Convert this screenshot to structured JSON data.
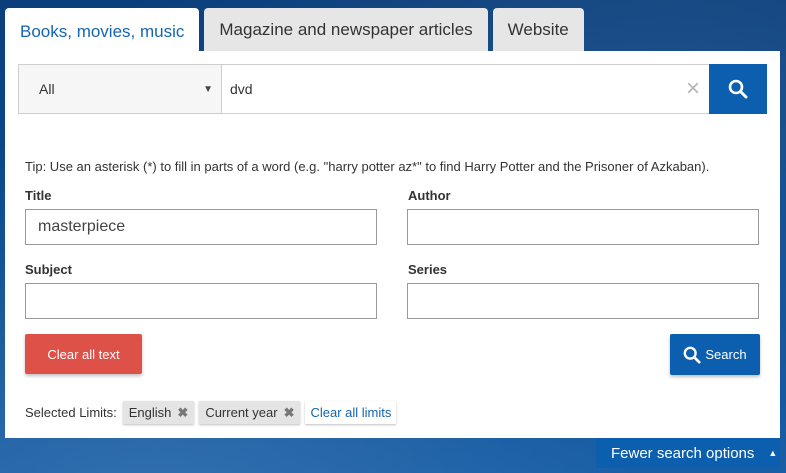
{
  "tabs": [
    {
      "label": "Books, movies, music"
    },
    {
      "label": "Magazine and newspaper articles"
    },
    {
      "label": "Website"
    }
  ],
  "search": {
    "scope": "All",
    "query": "dvd"
  },
  "tip": "Tip: Use an asterisk (*) to fill in parts of a word (e.g. \"harry potter az*\" to find Harry Potter and the Prisoner of Azkaban).",
  "fields": {
    "title_label": "Title",
    "title_value": "masterpiece",
    "author_label": "Author",
    "author_value": "",
    "subject_label": "Subject",
    "subject_value": "",
    "series_label": "Series",
    "series_value": ""
  },
  "buttons": {
    "clear_all_text": "Clear all text",
    "search": "Search"
  },
  "limits": {
    "label": "Selected Limits:",
    "chips": [
      "English",
      "Current year"
    ],
    "clear_all": "Clear all limits"
  },
  "footer": {
    "fewer_options": "Fewer search options"
  },
  "colors": {
    "primary": "#0b5fae",
    "danger": "#de5149",
    "link": "#1565b0"
  }
}
